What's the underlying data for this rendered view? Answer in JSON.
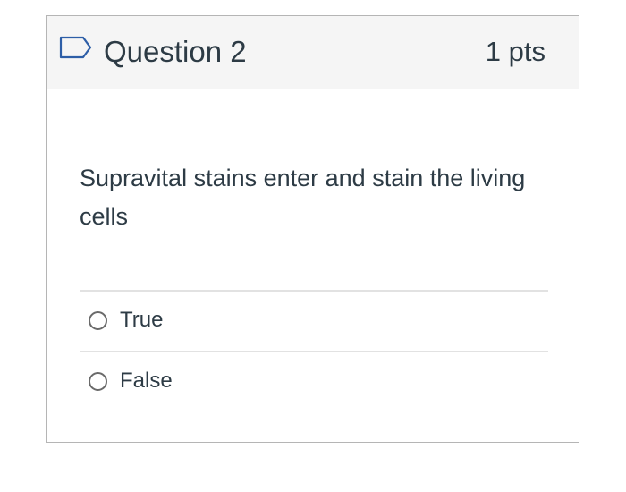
{
  "question": {
    "title": "Question 2",
    "points": "1 pts",
    "text": "Supravital stains enter and stain the living cells",
    "flag_icon": "flag-outline-icon"
  },
  "answers": [
    {
      "label": "True",
      "selected": false
    },
    {
      "label": "False",
      "selected": false
    }
  ],
  "colors": {
    "header_bg": "#f5f5f5",
    "border": "#b5b5b5",
    "text": "#2d3b45",
    "flag": "#2d5ea7"
  }
}
